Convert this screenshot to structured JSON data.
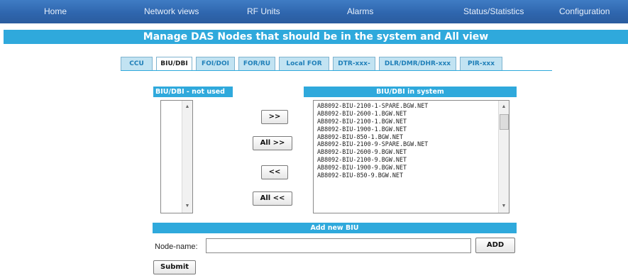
{
  "nav": {
    "items": [
      {
        "label": "Home"
      },
      {
        "label": "Network views"
      },
      {
        "label": "RF Units"
      },
      {
        "label": "Alarms"
      },
      {
        "label": "Status/Statistics"
      },
      {
        "label": "Configuration"
      }
    ]
  },
  "page_title": "Manage DAS Nodes that should be in the system and All view",
  "tabs": [
    {
      "label": "CCU",
      "active": false
    },
    {
      "label": "BIU/DBI",
      "active": true
    },
    {
      "label": "FOI/DOI",
      "active": false
    },
    {
      "label": "FOR/RU",
      "active": false
    },
    {
      "label": "Local FOR",
      "active": false
    },
    {
      "label": "DTR-xxx-",
      "active": false
    },
    {
      "label": "DLR/DMR/DHR-xxx",
      "active": false
    },
    {
      "label": "PIR-xxx",
      "active": false
    }
  ],
  "not_used": {
    "header": "BIU/DBI - not used",
    "items": []
  },
  "in_system": {
    "header": "BIU/DBI in system",
    "items": [
      "AB8092-BIU-2100-1-SPARE.BGW.NET",
      "AB8092-BIU-2600-1.BGW.NET",
      "AB8092-BIU-2100-1.BGW.NET",
      "AB8092-BIU-1900-1.BGW.NET",
      "AB8092-BIU-850-1.BGW.NET",
      "AB8092-BIU-2100-9-SPARE.BGW.NET",
      "AB8092-BIU-2600-9.BGW.NET",
      "AB8092-BIU-2100-9.BGW.NET",
      "AB8092-BIU-1900-9.BGW.NET",
      "AB8092-BIU-850-9.BGW.NET"
    ]
  },
  "buttons": {
    "move_right": ">>",
    "move_all_right": "All >>",
    "move_left": "<<",
    "move_all_left": "All <<",
    "add": "ADD",
    "submit": "Submit"
  },
  "add_section": {
    "header": "Add new BIU",
    "node_label": "Node-name:",
    "node_value": ""
  },
  "icons": {
    "scroll_up": "scroll-up-arrow",
    "scroll_down": "scroll-down-arrow"
  },
  "colors": {
    "nav_bg": "#2f66ae",
    "accent": "#2fa9dc",
    "tab_bg": "#c2e3f2"
  }
}
